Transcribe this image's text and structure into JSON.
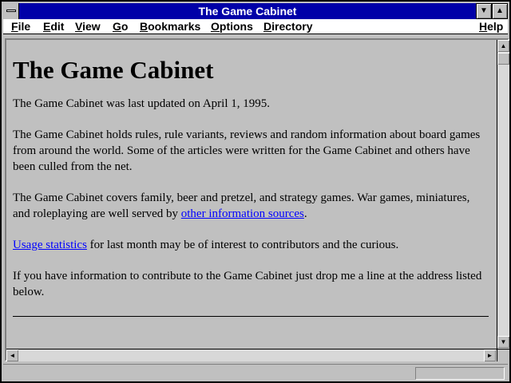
{
  "window": {
    "title": "The Game Cabinet"
  },
  "menu": {
    "items": [
      {
        "label": "File",
        "accel": "F",
        "rest": "ile"
      },
      {
        "label": "Edit",
        "accel": "E",
        "rest": "dit"
      },
      {
        "label": "View",
        "accel": "V",
        "rest": "iew"
      },
      {
        "label": "Go",
        "accel": "G",
        "rest": "o"
      },
      {
        "label": "Bookmarks",
        "accel": "B",
        "rest": "ookmarks"
      },
      {
        "label": "Options",
        "accel": "O",
        "rest": "ptions"
      },
      {
        "label": "Directory",
        "accel": "D",
        "rest": "irectory"
      },
      {
        "label": "Help",
        "accel": "H",
        "rest": "elp"
      }
    ]
  },
  "page": {
    "heading": "The Game Cabinet",
    "p1": "The Game Cabinet was last updated on April 1, 1995.",
    "p2": "The Game Cabinet holds rules, rule variants, reviews and random information about board games from around the world. Some of the articles were written for the Game Cabinet and others have been culled from the net.",
    "p3_before": "The Game Cabinet covers family, beer and pretzel, and strategy games. War games, miniatures, and roleplaying are well served by ",
    "p3_link": "other information sources",
    "p3_after": ".",
    "p4_link": "Usage statistics",
    "p4_after": " for last month may be of interest to contributors and the curious.",
    "p5": "If you have information to contribute to the Game Cabinet just drop me a line at the address listed below."
  },
  "scrollbar": {
    "up_glyph": "▲",
    "down_glyph": "▼",
    "left_glyph": "◄",
    "right_glyph": "►",
    "minimize_glyph": "▼",
    "maximize_glyph": "▲"
  },
  "status": {
    "text": ""
  }
}
